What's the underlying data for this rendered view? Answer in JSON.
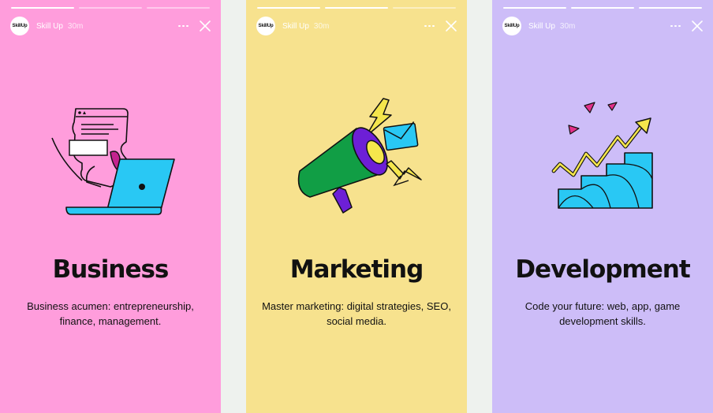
{
  "account": {
    "name": "Skill Up",
    "avatar_text": "SkillUp",
    "time": "30m"
  },
  "stories": [
    {
      "title": "Business",
      "description": "Business acumen: entrepreneurship, finance, management.",
      "background": "#ff9ddc",
      "progress": [
        1,
        0,
        0
      ],
      "illustration": "document-laptop-illustration"
    },
    {
      "title": "Marketing",
      "description": "Master marketing: digital strategies, SEO, social media.",
      "background": "#f7e28e",
      "progress": [
        1,
        1,
        0
      ],
      "illustration": "megaphone-illustration"
    },
    {
      "title": "Development",
      "description": "Code your future: web, app, game development skills.",
      "background": "#cdbdf8",
      "progress": [
        1,
        1,
        1
      ],
      "illustration": "growth-chart-illustration"
    }
  ],
  "colors": {
    "page_background": "#eef2ee",
    "cyan": "#29c8f4",
    "green": "#119e45",
    "purple": "#6d1fd6",
    "yellow": "#f5e64c",
    "magenta": "#e3318a"
  }
}
